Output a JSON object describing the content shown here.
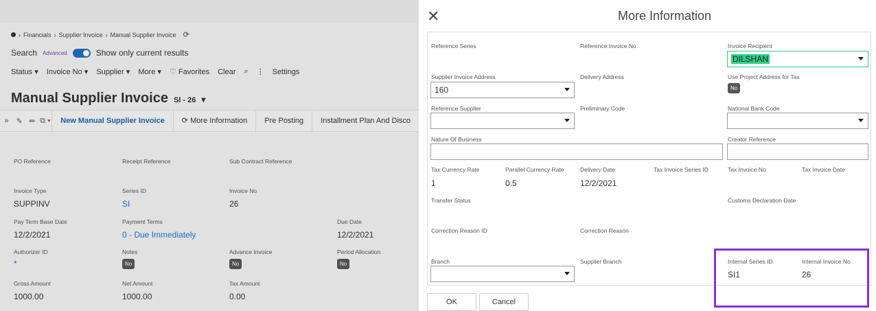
{
  "breadcrumb": {
    "items": [
      "Financials",
      "Supplier Invoice",
      "Manual Supplier Invoice"
    ]
  },
  "search": {
    "label": "Search",
    "advanced": "Advanced",
    "current_results": "Show only current results"
  },
  "filters": {
    "status": "Status",
    "invoice_no": "Invoice No",
    "supplier": "Supplier",
    "more": "More",
    "favorites": "Favorites",
    "clear": "Clear",
    "settings": "Settings"
  },
  "page": {
    "title": "Manual Supplier Invoice",
    "series_id": "SI - 26"
  },
  "toolbar": {
    "new_invoice": "New Manual Supplier Invoice",
    "more_info": "More Information",
    "pre_posting": "Pre Posting",
    "installment": "Installment Plan And Disco"
  },
  "detail": {
    "po_reference": "PO Reference",
    "receipt_reference": "Receipt Reference",
    "sub_contract_reference": "Sub Contract Reference",
    "invoice_type_label": "Invoice Type",
    "invoice_type": "SUPPINV",
    "series_id_label": "Series ID",
    "series_id": "SI",
    "invoice_no_label": "Invoice No",
    "invoice_no": "26",
    "pay_term_label": "Pay Term Base Date",
    "pay_term": "12/2/2021",
    "payment_terms_label": "Payment Terms",
    "payment_terms": "0 - Due Immediately",
    "due_date_label": "Due Date",
    "due_date": "12/2/2021",
    "authorizer_label": "Authorizer ID",
    "authorizer": "*",
    "notes_label": "Notes",
    "notes": "No",
    "advance_label": "Advance Invoice",
    "advance": "No",
    "period_label": "Period Allocation",
    "period": "No",
    "gross_label": "Gross Amount",
    "gross": "1000.00",
    "net_label": "Net Amount",
    "net": "1000.00",
    "tax_label": "Tax Amount",
    "tax": "0.00"
  },
  "modal": {
    "title": "More Information",
    "reference_series": "Reference Series",
    "reference_invoice_no": "Reference Invoice No",
    "invoice_recipient_label": "Invoice Recipient",
    "invoice_recipient": "DILSHAN",
    "supplier_invoice_address_label": "Supplier Invoice Address",
    "supplier_invoice_address": "160",
    "delivery_address": "Delivery Address",
    "use_project_address_label": "Use Project Address for Tax",
    "use_project_address": "No",
    "reference_supplier": "Reference Supplier",
    "preliminary_code": "Preliminary Code",
    "national_bank_code": "National Bank Code",
    "nature_of_business": "Nature Of Business",
    "creator_reference": "Creator Reference",
    "tax_currency_rate_label": "Tax Currency Rate",
    "tax_currency_rate": "1",
    "parallel_currency_rate_label": "Parallel Currency Rate",
    "parallel_currency_rate": "0.5",
    "delivery_date_label": "Delivery Date",
    "delivery_date": "12/2/2021",
    "tax_invoice_series_id": "Tax Invoice Series ID",
    "tax_invoice_no": "Tax Invoice No",
    "tax_invoice_date": "Tax Invoice Date",
    "transfer_status": "Transfer Status",
    "customs_declaration_date": "Customs Declaration Date",
    "correction_reason_id": "Correction Reason ID",
    "correction_reason": "Correction Reason",
    "branch": "Branch",
    "supplier_branch": "Supplier Branch",
    "internal_series_id_label": "Internal Series ID",
    "internal_series_id": "SI1",
    "internal_invoice_no_label": "Internal Invoice No",
    "internal_invoice_no": "26",
    "ok": "OK",
    "cancel": "Cancel"
  },
  "colors": {
    "accent": "#1e73c7",
    "highlight": "#8b2fd6",
    "recipient_highlight": "#2fcf83"
  }
}
